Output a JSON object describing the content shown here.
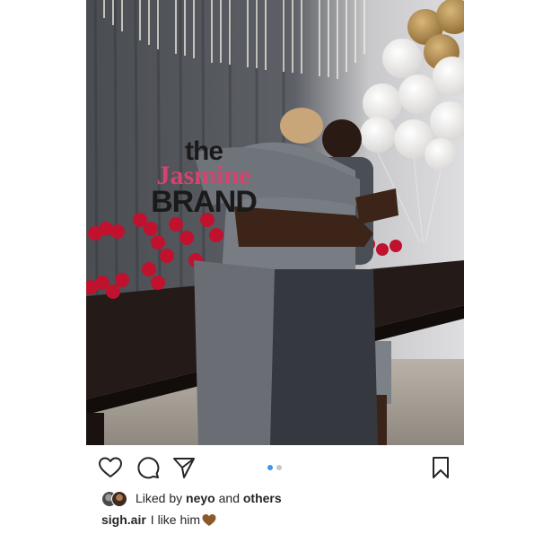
{
  "watermark": {
    "line1": "the",
    "line2": "Jasmine",
    "line3": "BRAND"
  },
  "post": {
    "carousel": {
      "current_index": 1,
      "total": 2
    },
    "icons": {
      "like": "heart-outline-icon",
      "comment": "speech-bubble-icon",
      "share": "paper-plane-icon",
      "save": "bookmark-icon"
    },
    "likes": {
      "prefix": "Liked by",
      "user": "neyo",
      "conjunction": "and",
      "others": "others"
    },
    "caption": {
      "username": "sigh.air",
      "text": "I like him",
      "emoji": "brown-heart-emoji"
    }
  },
  "colors": {
    "accent_dot": "#3897f0",
    "inactive_dot": "#c7c7c7",
    "text": "#262626",
    "watermark_pink": "#d3446e",
    "heart_emoji": "#8b5a2b"
  }
}
